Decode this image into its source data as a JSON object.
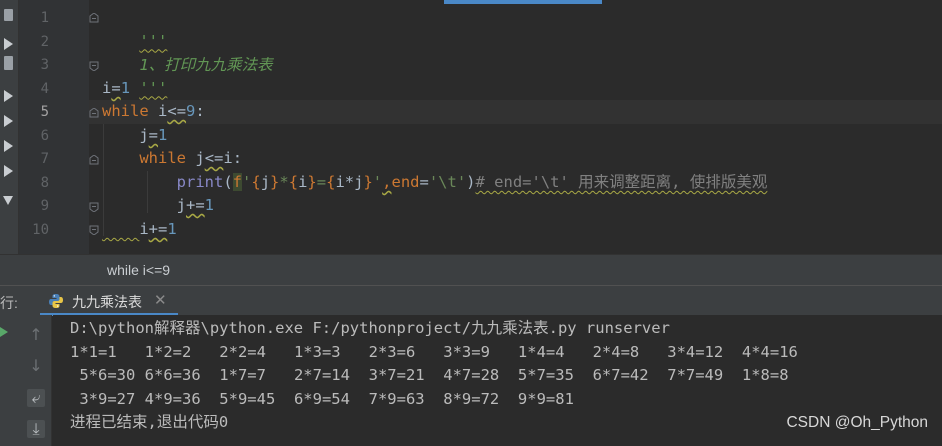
{
  "editor": {
    "line_numbers": [
      "1",
      "2",
      "3",
      "4",
      "5",
      "6",
      "7",
      "8",
      "9",
      "10"
    ],
    "current_line": "5",
    "lines": {
      "l1": {
        "doc": "'''"
      },
      "l2": {
        "doc": "1、打印九九乘法表"
      },
      "l3": {
        "doc": "'''"
      },
      "l4": {
        "var": "i",
        "op": "=",
        "num": "1"
      },
      "l5": {
        "kw": "while",
        "sp": " ",
        "var": "i",
        "op": "<=",
        "num": "9",
        "colon": ":"
      },
      "l6": {
        "indent": "    ",
        "var": "j",
        "op": "=",
        "num": "1"
      },
      "l7": {
        "indent": "    ",
        "kw": "while",
        "sp": " ",
        "var": "j",
        "op": "<=",
        "rhs": "i:"
      },
      "l8": {
        "indent": "        ",
        "fn": "print",
        "paren": "(",
        "fprefix": "f",
        "q1": "'",
        "b1": "{",
        "v1": "j",
        "b2": "}",
        "star": "*",
        "b3": "{",
        "v2": "i",
        "b4": "}",
        "eq": "=",
        "b5": "{",
        "v3": "i*j",
        "b6": "}",
        "q2": "'",
        "comma": ",",
        "kwarg": "end",
        "assign": "=",
        "endstr": "'\\t'",
        "close": ")",
        "comment": "# end='\\t' 用来调整距离, 使排版美观"
      },
      "l9": {
        "indent": "        ",
        "var": "j",
        "op": "+=",
        "num": "1"
      },
      "l10": {
        "indent": "    ",
        "var": "i",
        "op": "+=",
        "num": "1"
      }
    }
  },
  "breadcrumb": {
    "text": "while i<=9"
  },
  "run_panel": {
    "label": "运行:",
    "tab_label": "九九乘法表",
    "close_glyph": "✕",
    "side_icons": {
      "up": "↑",
      "down": "↓",
      "wrap": "⤶",
      "scroll": "⤓"
    }
  },
  "console": {
    "lines": [
      "D:\\python解释器\\python.exe F:/pythonproject/九九乘法表.py runserver",
      "1*1=1   1*2=2   2*2=4   1*3=3   2*3=6   3*3=9   1*4=4   2*4=8   3*4=12  4*4=16",
      " 5*6=30 6*6=36  1*7=7   2*7=14  3*7=21  4*7=28  5*7=35  6*7=42  7*7=49  1*8=8",
      " 3*9=27 4*9=36  5*9=45  6*9=54  7*9=63  8*9=72  9*9=81",
      "进程已结束,退出代码0"
    ]
  },
  "watermark": "CSDN @Oh_Python",
  "colors": {
    "keyword": "#cc7832",
    "number": "#6897bb",
    "string": "#6a8759",
    "docstring": "#629755",
    "builtin": "#8888c6",
    "comment": "#808080",
    "accent": "#4a88c7"
  }
}
